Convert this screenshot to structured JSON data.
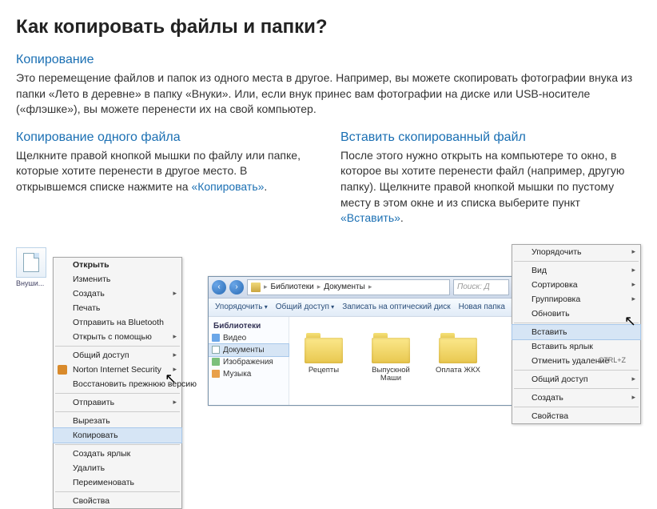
{
  "title": "Как копировать файлы и папки?",
  "copy": {
    "heading": "Копирование",
    "body": "Это перемещение файлов и папок из одного места в другое. Например, вы можете скопировать фотографии внука из папки «Лето в деревне» в папку «Внуки». Или, если внук принес вам фотографии на диске или USB-носителе («флэшке»), вы можете перенести их на свой компьютер."
  },
  "copy_one": {
    "heading": "Копирование одного файла",
    "body_before": "Щелкните правой кнопкой мышки по файлу или папке, которые хотите перенести в другое место. В открывшемся списке нажмите на ",
    "link": "«Копировать»",
    "body_after": "."
  },
  "paste": {
    "heading": "Вставить скопированный файл",
    "body_before": "После этого нужно открыть на компьютере то окно, в которое вы хотите перенести файл (например, другую папку). Щелкните правой кнопкой мышки по пустому месту в этом окне и из списка выберите пункт ",
    "link": "«Вставить»",
    "body_after": "."
  },
  "left_menu": {
    "thumb_label": "Внуши...",
    "items": [
      {
        "label": "Открыть",
        "bold": true
      },
      {
        "label": "Изменить"
      },
      {
        "label": "Создать",
        "sub": true
      },
      {
        "label": "Печать"
      },
      {
        "label": "Отправить на Bluetooth"
      },
      {
        "label": "Открыть с помощью",
        "sub": true
      },
      {
        "sep": true
      },
      {
        "label": "Общий доступ",
        "sub": true
      },
      {
        "label": "Norton Internet Security",
        "sub": true,
        "ico": true
      },
      {
        "label": "Восстановить прежнюю версию"
      },
      {
        "sep": true
      },
      {
        "label": "Отправить",
        "sub": true
      },
      {
        "sep": true
      },
      {
        "label": "Вырезать"
      },
      {
        "label": "Копировать",
        "hl": true
      },
      {
        "sep": true
      },
      {
        "label": "Создать ярлык"
      },
      {
        "label": "Удалить"
      },
      {
        "label": "Переименовать"
      },
      {
        "sep": true
      },
      {
        "label": "Свойства"
      }
    ]
  },
  "explorer": {
    "path": [
      "Библиотеки",
      "Документы"
    ],
    "search_placeholder": "Поиск: Д",
    "toolbar": [
      {
        "label": "Упорядочить",
        "sub": true
      },
      {
        "label": "Общий доступ",
        "sub": true
      },
      {
        "label": "Записать на оптический диск"
      },
      {
        "label": "Новая папка"
      }
    ],
    "sidebar_header": "Библиотеки",
    "sidebar": [
      {
        "label": "Видео",
        "ico": "ico-vid"
      },
      {
        "label": "Документы",
        "ico": "ico-doc",
        "sel": true
      },
      {
        "label": "Изображения",
        "ico": "ico-img"
      },
      {
        "label": "Музыка",
        "ico": "ico-mus"
      }
    ],
    "folders": [
      {
        "label": "Рецепты"
      },
      {
        "label": "Выпускной Маши"
      },
      {
        "label": "Оплата ЖКХ"
      }
    ]
  },
  "right_menu": {
    "items": [
      {
        "label": "Упорядочить",
        "sub": true
      },
      {
        "sep": true
      },
      {
        "label": "Вид",
        "sub": true
      },
      {
        "label": "Сортировка",
        "sub": true
      },
      {
        "label": "Группировка",
        "sub": true
      },
      {
        "label": "Обновить"
      },
      {
        "sep": true
      },
      {
        "label": "Вставить",
        "hl": true
      },
      {
        "label": "Вставить ярлык"
      },
      {
        "label": "Отменить удаление",
        "kb": "CTRL+Z"
      },
      {
        "sep": true
      },
      {
        "label": "Общий доступ",
        "sub": true
      },
      {
        "sep": true
      },
      {
        "label": "Создать",
        "sub": true
      },
      {
        "sep": true
      },
      {
        "label": "Свойства"
      }
    ]
  }
}
